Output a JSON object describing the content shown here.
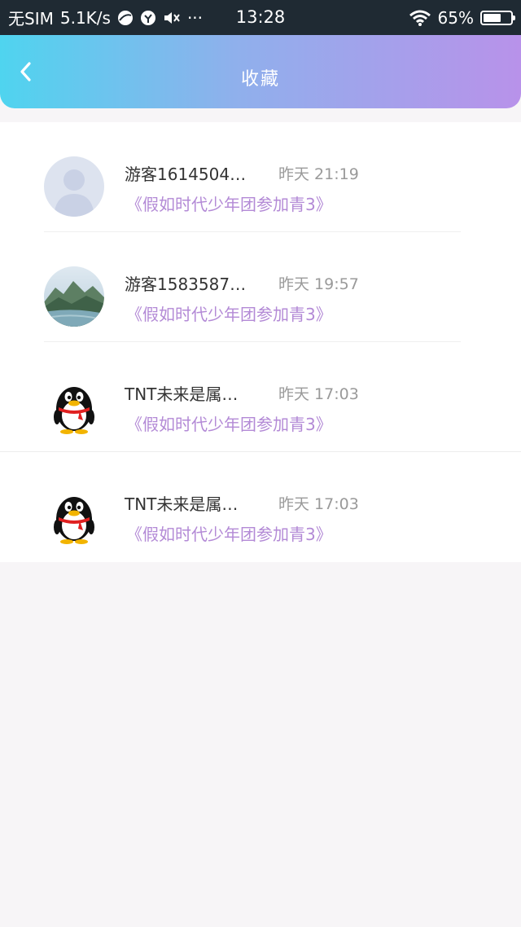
{
  "status_bar": {
    "carrier": "无SIM",
    "speed": "5.1K/s",
    "dots": "···",
    "time": "13:28",
    "battery": "65%",
    "battery_level": 0.65,
    "icons": [
      "browser-icon",
      "sync-icon",
      "mute-icon",
      "wifi-icon",
      "battery-icon"
    ]
  },
  "header": {
    "title": "收藏",
    "back_icon": "chevron-left-icon",
    "gradient": [
      "#4fd4ef",
      "#b892ea"
    ]
  },
  "colors": {
    "accent_text": "#b38ad6",
    "name_text": "#333333",
    "time_text": "#9a9a9a"
  },
  "favorites": [
    {
      "avatar": "default-user-avatar",
      "name": "游客1614504…",
      "time": "昨天 21:19",
      "title": "《假如时代少年团参加青3》"
    },
    {
      "avatar": "landscape-avatar",
      "name": "游客1583587…",
      "time": "昨天 19:57",
      "title": "《假如时代少年团参加青3》"
    },
    {
      "avatar": "penguin-avatar",
      "name": "TNT未来是属…",
      "time": "昨天 17:03",
      "title": "《假如时代少年团参加青3》"
    },
    {
      "avatar": "penguin-avatar",
      "name": "TNT未来是属…",
      "time": "昨天 17:03",
      "title": "《假如时代少年团参加青3》"
    }
  ]
}
